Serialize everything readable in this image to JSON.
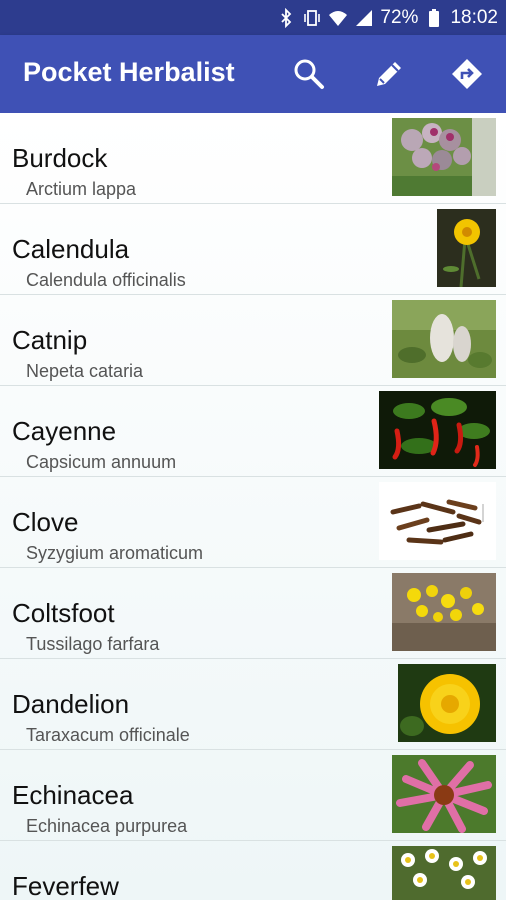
{
  "status_bar": {
    "battery_percent": "72%",
    "time": "18:02",
    "icons": [
      "bluetooth-icon",
      "vibrate-icon",
      "wifi-icon",
      "signal-icon",
      "battery-icon"
    ]
  },
  "app_bar": {
    "title": "Pocket Herbalist",
    "actions": [
      "search-icon",
      "edit-pencil-icon",
      "directions-icon"
    ],
    "color": "#3f51b5"
  },
  "herbs": [
    {
      "name": "Burdock",
      "latin": "Arctium lappa",
      "image": "burdock-photo"
    },
    {
      "name": "Calendula",
      "latin": "Calendula officinalis",
      "image": "calendula-photo"
    },
    {
      "name": "Catnip",
      "latin": "Nepeta cataria",
      "image": "catnip-photo"
    },
    {
      "name": "Cayenne",
      "latin": "Capsicum annuum",
      "image": "cayenne-photo"
    },
    {
      "name": "Clove",
      "latin": "Syzygium aromaticum",
      "image": "clove-photo"
    },
    {
      "name": "Coltsfoot",
      "latin": "Tussilago farfara",
      "image": "coltsfoot-photo"
    },
    {
      "name": "Dandelion",
      "latin": "Taraxacum officinale",
      "image": "dandelion-photo"
    },
    {
      "name": "Echinacea",
      "latin": "Echinacea purpurea",
      "image": "echinacea-photo"
    },
    {
      "name": "Feverfew",
      "latin": "",
      "image": "feverfew-photo"
    }
  ]
}
